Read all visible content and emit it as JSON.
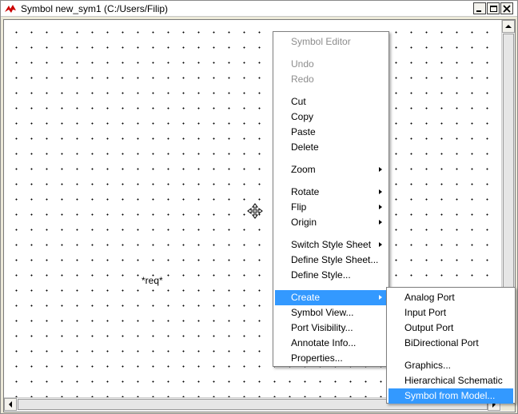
{
  "window": {
    "title": "Symbol new_sym1 (C:/Users/Filip)",
    "controls": [
      "minimize",
      "maximize",
      "close"
    ]
  },
  "canvas": {
    "label": "*req*"
  },
  "context_menu": {
    "header": "Symbol Editor",
    "items": [
      {
        "label": "Undo",
        "disabled": true
      },
      {
        "label": "Redo",
        "disabled": true
      },
      {
        "label": "Cut"
      },
      {
        "label": "Copy"
      },
      {
        "label": "Paste"
      },
      {
        "label": "Delete"
      },
      {
        "label": "Zoom",
        "submenu": true
      },
      {
        "label": "Rotate",
        "submenu": true
      },
      {
        "label": "Flip",
        "submenu": true
      },
      {
        "label": "Origin",
        "submenu": true
      },
      {
        "label": "Switch Style Sheet",
        "submenu": true
      },
      {
        "label": "Define Style Sheet..."
      },
      {
        "label": "Define Style..."
      },
      {
        "label": "Create",
        "submenu": true,
        "selected": true
      },
      {
        "label": "Symbol View..."
      },
      {
        "label": "Port Visibility..."
      },
      {
        "label": "Annotate Info..."
      },
      {
        "label": "Properties..."
      }
    ]
  },
  "create_submenu": {
    "items": [
      {
        "label": "Analog Port"
      },
      {
        "label": "Input Port"
      },
      {
        "label": "Output Port"
      },
      {
        "label": "BiDirectional Port"
      },
      {
        "label": "Graphics..."
      },
      {
        "label": "Hierarchical Schematic"
      },
      {
        "label": "Symbol from Model...",
        "selected": true
      }
    ]
  },
  "colors": {
    "selection": "#3399ff",
    "disabled_text": "#8d8d8d",
    "app_icon": "#cc0000"
  },
  "icons": [
    "app-icon",
    "minimize-icon",
    "maximize-icon",
    "close-icon",
    "move-cursor-icon",
    "scroll-up-icon",
    "scroll-down-icon",
    "scroll-left-icon",
    "scroll-right-icon",
    "submenu-arrow-icon"
  ]
}
